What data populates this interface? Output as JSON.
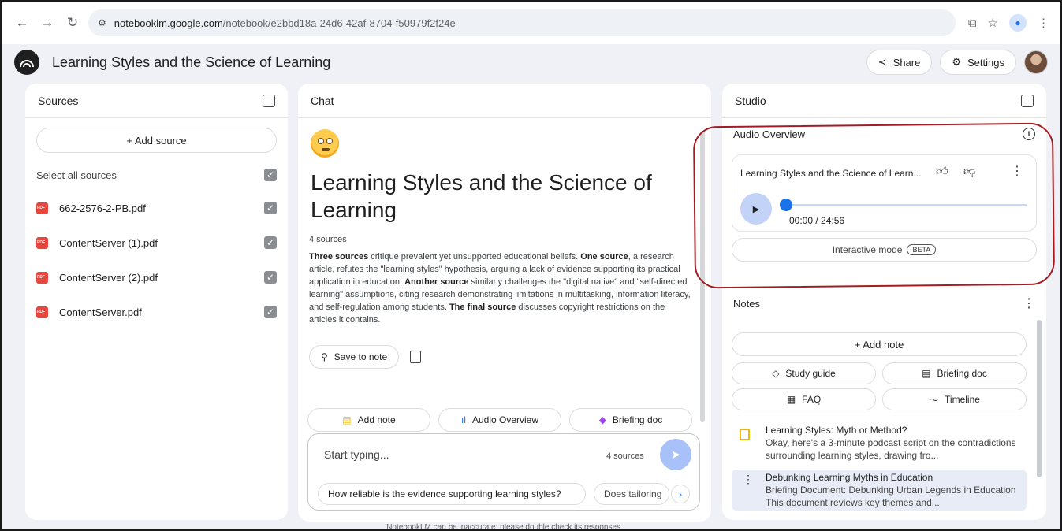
{
  "browser": {
    "url_host": "notebooklm.google.com",
    "url_path": "/notebook/e2bbd18a-24d6-42af-8704-f50979f2f24e"
  },
  "header": {
    "title": "Learning Styles and the Science of Learning",
    "share_label": "Share",
    "settings_label": "Settings"
  },
  "sources": {
    "title": "Sources",
    "add_label": "+ Add source",
    "select_all_label": "Select all sources",
    "items": [
      {
        "name": "662-2576-2-PB.pdf"
      },
      {
        "name": "ContentServer (1).pdf"
      },
      {
        "name": "ContentServer (2).pdf"
      },
      {
        "name": "ContentServer.pdf"
      }
    ]
  },
  "chat": {
    "title": "Chat",
    "notebook_title": "Learning Styles and the Science of Learning",
    "source_count": "4 sources",
    "summary": [
      {
        "bold": "Three sources",
        "text": " critique prevalent yet unsupported educational beliefs. "
      },
      {
        "bold": "One source",
        "text": ", a research article, refutes the \"learning styles\" hypothesis, arguing a lack of evidence supporting its practical application in education. "
      },
      {
        "bold": "Another source",
        "text": " similarly challenges the \"digital native\" and \"self-directed learning\" assumptions, citing research demonstrating limitations in multitasking, information literacy, and self-regulation among students. "
      },
      {
        "bold": "The final source",
        "text": " discusses copyright restrictions on the articles it contains."
      }
    ],
    "save_to_note_label": "Save to note",
    "quick_actions": [
      "Add note",
      "Audio Overview",
      "Briefing doc"
    ],
    "input_placeholder": "Start typing...",
    "input_source_count": "4 sources",
    "suggestions": [
      "How reliable is the evidence supporting learning styles?",
      "Does tailoring"
    ],
    "disclaimer": "NotebookLM can be inaccurate; please double check its responses."
  },
  "studio": {
    "title": "Studio",
    "audio_overview": {
      "heading": "Audio Overview",
      "item_title": "Learning Styles and the Science of Learn...",
      "time": "00:00 / 24:56",
      "progress": 0.0,
      "interactive_label": "Interactive mode",
      "beta_label": "BETA"
    },
    "notes": {
      "heading": "Notes",
      "add_label": "+ Add note",
      "buttons": [
        "Study guide",
        "Briefing doc",
        "FAQ",
        "Timeline"
      ],
      "items": [
        {
          "title": "Learning Styles: Myth or Method?",
          "body": "Okay, here's a 3-minute podcast script on the contradictions surrounding learning styles, drawing fro..."
        },
        {
          "title": "Debunking Learning Myths in Education",
          "body": "Briefing Document: Debunking Urban Legends in Education This document reviews key themes and..."
        }
      ]
    }
  },
  "colors": {
    "accent": "#1a73e8",
    "highlight": "#a31c24",
    "pdf": "#e8453c"
  }
}
